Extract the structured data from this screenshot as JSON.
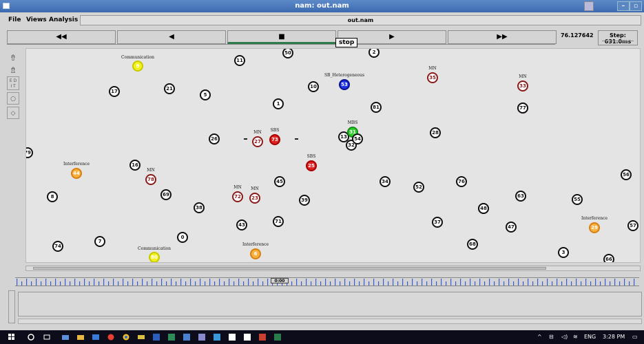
{
  "window": {
    "title": "nam: out.nam"
  },
  "menu": {
    "file": "File",
    "views": "Views",
    "analysis": "Analysis",
    "filename": "out.nam"
  },
  "transport": {
    "rewind_fast": "◀◀",
    "rewind": "◀",
    "stop": "■",
    "play": "▶",
    "forward_fast": "▶▶",
    "tooltip": "stop",
    "time": "76.127642",
    "step": "Step: 631.0ms"
  },
  "canvas": {
    "nodes": [
      {
        "id": "n1",
        "label": "1",
        "style": "plain"
      },
      {
        "id": "n3",
        "label": "3",
        "style": "plain"
      },
      {
        "id": "n5",
        "label": "5",
        "style": "plain"
      },
      {
        "id": "n6",
        "label": "6",
        "style": "orange"
      },
      {
        "id": "n7",
        "label": "7",
        "style": "plain"
      },
      {
        "id": "n8",
        "label": "8",
        "style": "plain"
      },
      {
        "id": "n9",
        "label": "9",
        "style": "yellow"
      },
      {
        "id": "n10",
        "label": "10",
        "style": "plain"
      },
      {
        "id": "n11",
        "label": "11",
        "style": "plain"
      },
      {
        "id": "n13",
        "label": "13",
        "style": "plain"
      },
      {
        "id": "n16",
        "label": "16",
        "style": "plain"
      },
      {
        "id": "n17",
        "label": "17",
        "style": "plain"
      },
      {
        "id": "n21",
        "label": "21",
        "style": "plain"
      },
      {
        "id": "n23",
        "label": "23",
        "style": "maroon"
      },
      {
        "id": "n24",
        "label": "24",
        "style": "plain"
      },
      {
        "id": "n25",
        "label": "25",
        "style": "red"
      },
      {
        "id": "n26",
        "label": "26",
        "style": "plain"
      },
      {
        "id": "n27",
        "label": "27",
        "style": "maroon"
      },
      {
        "id": "n28",
        "label": "28",
        "style": "plain"
      },
      {
        "id": "n29",
        "label": "29",
        "style": "orange"
      },
      {
        "id": "n30",
        "label": "30",
        "style": "plain"
      },
      {
        "id": "n31",
        "label": "31",
        "style": "green"
      },
      {
        "id": "n32",
        "label": "32",
        "style": "plain"
      },
      {
        "id": "n33",
        "label": "33",
        "style": "maroon"
      },
      {
        "id": "n34",
        "label": "34",
        "style": "plain"
      },
      {
        "id": "n35",
        "label": "35",
        "style": "maroon"
      },
      {
        "id": "n37",
        "label": "37",
        "style": "plain"
      },
      {
        "id": "n38",
        "label": "38",
        "style": "plain"
      },
      {
        "id": "n39",
        "label": "39",
        "style": "plain"
      },
      {
        "id": "n40",
        "label": "40",
        "style": "plain"
      },
      {
        "id": "n41",
        "label": "41",
        "style": "plain"
      },
      {
        "id": "n43",
        "label": "43",
        "style": "plain"
      },
      {
        "id": "n44",
        "label": "44",
        "style": "orange"
      },
      {
        "id": "n45",
        "label": "45",
        "style": "plain"
      },
      {
        "id": "n47",
        "label": "47",
        "style": "plain"
      },
      {
        "id": "n48",
        "label": "48",
        "style": "plain"
      },
      {
        "id": "n50",
        "label": "50",
        "style": "plain"
      },
      {
        "id": "n51",
        "label": "51",
        "style": "plain"
      },
      {
        "id": "n52",
        "label": "52",
        "style": "plain"
      },
      {
        "id": "n53",
        "label": "53",
        "style": "blue"
      },
      {
        "id": "n54",
        "label": "54",
        "style": "plain"
      },
      {
        "id": "n55",
        "label": "55",
        "style": "plain"
      },
      {
        "id": "n56",
        "label": "56",
        "style": "plain"
      },
      {
        "id": "n57",
        "label": "57",
        "style": "plain"
      },
      {
        "id": "n63",
        "label": "63",
        "style": "plain"
      },
      {
        "id": "n65",
        "label": "65",
        "style": "maroon"
      },
      {
        "id": "n66",
        "label": "66",
        "style": "plain"
      },
      {
        "id": "n67",
        "label": "67",
        "style": "plain"
      },
      {
        "id": "n68",
        "label": "68",
        "style": "plain"
      },
      {
        "id": "n69",
        "label": "69",
        "style": "plain"
      },
      {
        "id": "n70",
        "label": "70",
        "style": "plain"
      },
      {
        "id": "n71",
        "label": "71",
        "style": "plain"
      },
      {
        "id": "n72",
        "label": "72",
        "style": "maroon"
      },
      {
        "id": "n73",
        "label": "73",
        "style": "red"
      },
      {
        "id": "n74",
        "label": "74",
        "style": "plain"
      },
      {
        "id": "n76",
        "label": "76",
        "style": "plain"
      },
      {
        "id": "n77",
        "label": "77",
        "style": "plain"
      },
      {
        "id": "n78",
        "label": "78",
        "style": "maroon"
      },
      {
        "id": "n79",
        "label": "79",
        "style": "plain"
      },
      {
        "id": "n80",
        "label": "80",
        "style": "yellow"
      },
      {
        "id": "n81",
        "label": "81",
        "style": "plain"
      },
      {
        "id": "n0",
        "label": "0",
        "style": "plain"
      },
      {
        "id": "n2",
        "label": "2",
        "style": "plain"
      }
    ],
    "labels": [
      {
        "id": "l_comm1",
        "text": "Communication"
      },
      {
        "id": "l_comm2",
        "text": "Communication"
      },
      {
        "id": "l_sbhet",
        "text": "SB_Heterogeneous"
      },
      {
        "id": "l_mn35",
        "text": "MN"
      },
      {
        "id": "l_mn33",
        "text": "MN"
      },
      {
        "id": "l_mbs",
        "text": "MBS"
      },
      {
        "id": "l_mn27",
        "text": "MN"
      },
      {
        "id": "l_sbs73",
        "text": "SBS"
      },
      {
        "id": "l_sbs25",
        "text": "SBS"
      },
      {
        "id": "l_int44",
        "text": "Interference"
      },
      {
        "id": "l_mn78",
        "text": "MN"
      },
      {
        "id": "l_mn72",
        "text": "MN"
      },
      {
        "id": "l_mn23",
        "text": "MN"
      },
      {
        "id": "l_int29",
        "text": "Interference"
      },
      {
        "id": "l_int6",
        "text": "Interference"
      }
    ]
  },
  "timeline": {
    "label": "0:00"
  },
  "taskbar": {
    "lang": "ENG",
    "time": "3:28 PM"
  }
}
